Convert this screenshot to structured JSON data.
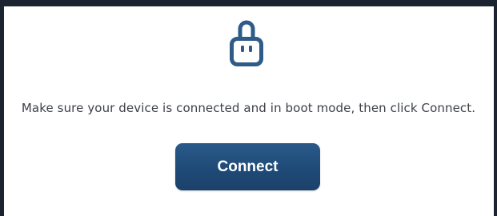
{
  "icons": {
    "device": "usb-plug-icon"
  },
  "colors": {
    "frame": "#1c2330",
    "icon": "#2e5b87",
    "button": "#1f4a77",
    "text": "#3d4148"
  },
  "instruction_text": "Make sure your device is connected and in boot mode, then click Connect.",
  "connect_button_label": "Connect"
}
